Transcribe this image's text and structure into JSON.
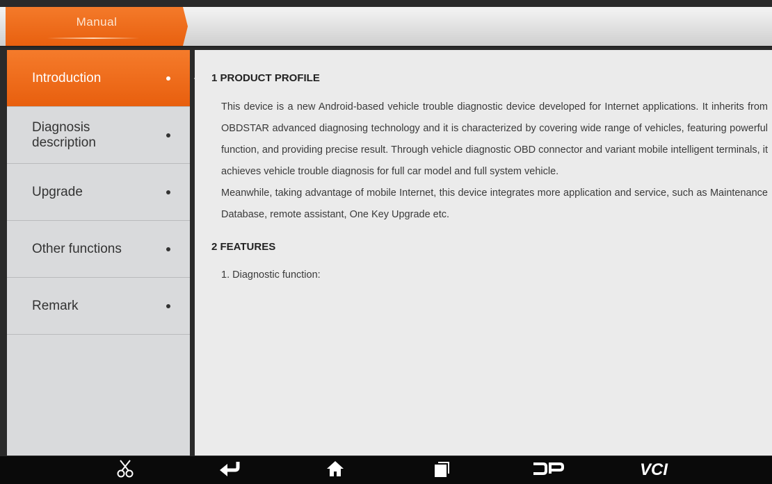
{
  "header": {
    "tab_label": "Manual"
  },
  "sidebar": {
    "items": [
      {
        "label": "Introduction",
        "active": true
      },
      {
        "label": "Diagnosis description",
        "active": false
      },
      {
        "label": "Upgrade",
        "active": false
      },
      {
        "label": "Other functions",
        "active": false
      },
      {
        "label": "Remark",
        "active": false
      }
    ]
  },
  "content": {
    "section1_title": "1 PRODUCT PROFILE",
    "para1": "This device is a new Android-based vehicle trouble diagnostic device developed for Internet applications. It inherits from OBDSTAR advanced diagnosing technology and it is characterized by covering wide range of vehicles, featuring powerful function, and providing precise result. Through vehicle diagnostic OBD connector and variant mobile intelligent terminals, it achieves vehicle trouble diagnosis for full car model and full system vehicle.",
    "para2": "Meanwhile, taking advantage of mobile Internet, this device integrates more application and service, such as Maintenance Database, remote assistant, One Key Upgrade etc.",
    "section2_title": "2 FEATURES",
    "list1": "1. Diagnostic function:"
  },
  "bottom_nav": {
    "icons": [
      "scissors-icon",
      "back-icon",
      "home-icon",
      "recent-apps-icon",
      "dp-icon",
      "vci-icon"
    ],
    "vci_label": "VCI"
  },
  "colors": {
    "accent": "#ef6d1e",
    "sidebar_bg": "#d9dadc",
    "content_bg": "#ebebeb",
    "nav_bg": "#0a0a0a"
  }
}
